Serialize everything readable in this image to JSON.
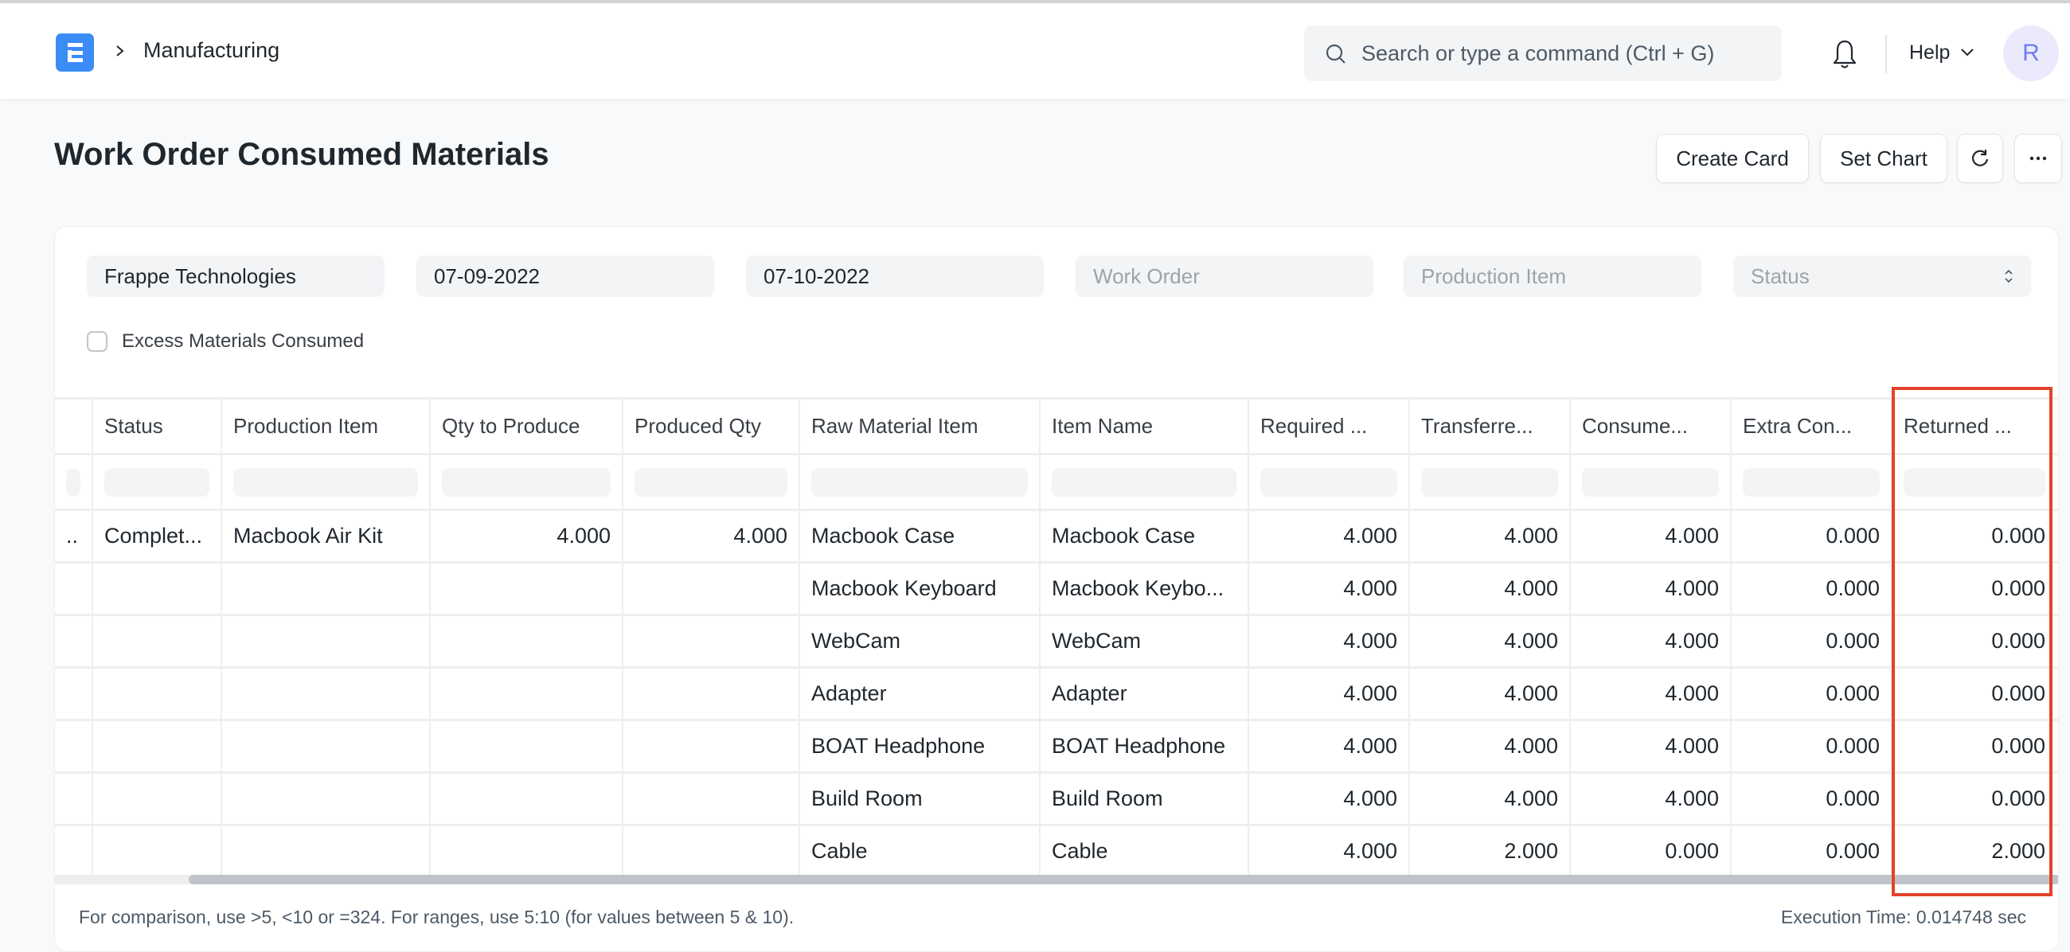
{
  "navbar": {
    "breadcrumb": "Manufacturing",
    "search_placeholder": "Search or type a command (Ctrl + G)",
    "help_label": "Help",
    "avatar_initial": "R"
  },
  "page": {
    "title": "Work Order Consumed Materials",
    "buttons": {
      "create_card": "Create Card",
      "set_chart": "Set Chart"
    }
  },
  "filters": {
    "company": "Frappe Technologies",
    "from_date": "07-09-2022",
    "to_date": "07-10-2022",
    "work_order_placeholder": "Work Order",
    "production_item_placeholder": "Production Item",
    "status_placeholder": "Status",
    "excess_checkbox_label": "Excess Materials Consumed",
    "excess_checked": false
  },
  "table": {
    "columns": [
      "",
      "Status",
      "Production Item",
      "Qty to Produce",
      "Produced Qty",
      "Raw Material Item",
      "Item Name",
      "Required ...",
      "Transferre...",
      "Consume...",
      "Extra Con...",
      "Returned ..."
    ],
    "rows": [
      [
        "..",
        "Complet...",
        "Macbook Air Kit",
        "4.000",
        "4.000",
        "Macbook Case",
        "Macbook Case",
        "4.000",
        "4.000",
        "4.000",
        "0.000",
        "0.000"
      ],
      [
        "",
        "",
        "",
        "",
        "",
        "Macbook Keyboard",
        "Macbook Keybo...",
        "4.000",
        "4.000",
        "4.000",
        "0.000",
        "0.000"
      ],
      [
        "",
        "",
        "",
        "",
        "",
        "WebCam",
        "WebCam",
        "4.000",
        "4.000",
        "4.000",
        "0.000",
        "0.000"
      ],
      [
        "",
        "",
        "",
        "",
        "",
        "Adapter",
        "Adapter",
        "4.000",
        "4.000",
        "4.000",
        "0.000",
        "0.000"
      ],
      [
        "",
        "",
        "",
        "",
        "",
        "BOAT Headphone",
        "BOAT Headphone",
        "4.000",
        "4.000",
        "4.000",
        "0.000",
        "0.000"
      ],
      [
        "",
        "",
        "",
        "",
        "",
        "Build Room",
        "Build Room",
        "4.000",
        "4.000",
        "4.000",
        "0.000",
        "0.000"
      ],
      [
        "",
        "",
        "",
        "",
        "",
        "Cable",
        "Cable",
        "4.000",
        "2.000",
        "0.000",
        "0.000",
        "2.000"
      ]
    ],
    "numeric_columns": [
      3,
      4,
      7,
      8,
      9,
      10,
      11
    ],
    "highlighted_column": "Returned ..."
  },
  "footer": {
    "hint": "For comparison, use >5, <10 or =324. For ranges, use 5:10 (for values between 5 & 10).",
    "execution_time": "Execution Time: 0.014748 sec"
  },
  "colors": {
    "brand": "#3a8cf7",
    "highlight_border": "#e4422a"
  }
}
